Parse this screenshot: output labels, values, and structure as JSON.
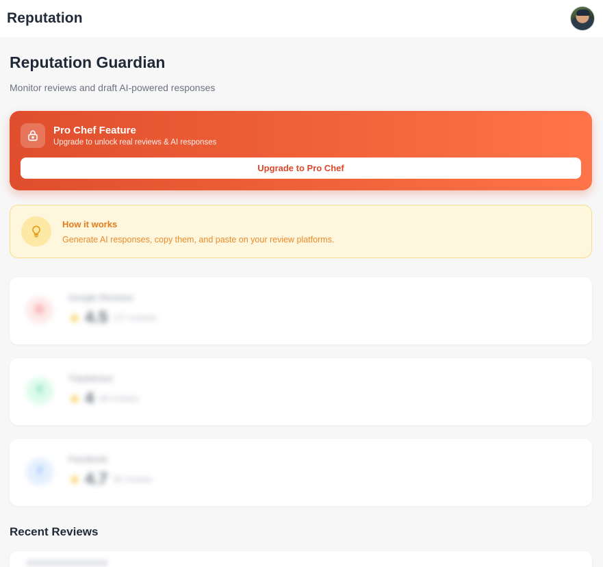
{
  "header": {
    "title": "Reputation"
  },
  "page": {
    "title": "Reputation Guardian",
    "subtitle": "Monitor reviews and draft AI-powered responses"
  },
  "pro_banner": {
    "title": "Pro Chef Feature",
    "subtitle": "Upgrade to unlock real reviews & AI responses",
    "button_label": "Upgrade to Pro Chef"
  },
  "how_it_works": {
    "title": "How it works",
    "description": "Generate AI responses, copy them, and paste on your review platforms."
  },
  "platforms": [
    {
      "name": "Google Reviews",
      "icon": "G",
      "rating": "4.5",
      "reviews": "127 reviews",
      "color": "#ef4444",
      "bg": "#fde2e2"
    },
    {
      "name": "TripAdvisor",
      "icon": "T",
      "rating": "4",
      "reviews": "89 reviews",
      "color": "#10b981",
      "bg": "#d1fae5"
    },
    {
      "name": "Facebook",
      "icon": "f",
      "rating": "4.7",
      "reviews": "56 reviews",
      "color": "#3b82f6",
      "bg": "#dbeafe"
    }
  ],
  "recent": {
    "title": "Recent Reviews"
  },
  "colors": {
    "accent": "#e04e2d",
    "accent_light": "#ff7448",
    "warning_bg": "#fff7dd"
  }
}
